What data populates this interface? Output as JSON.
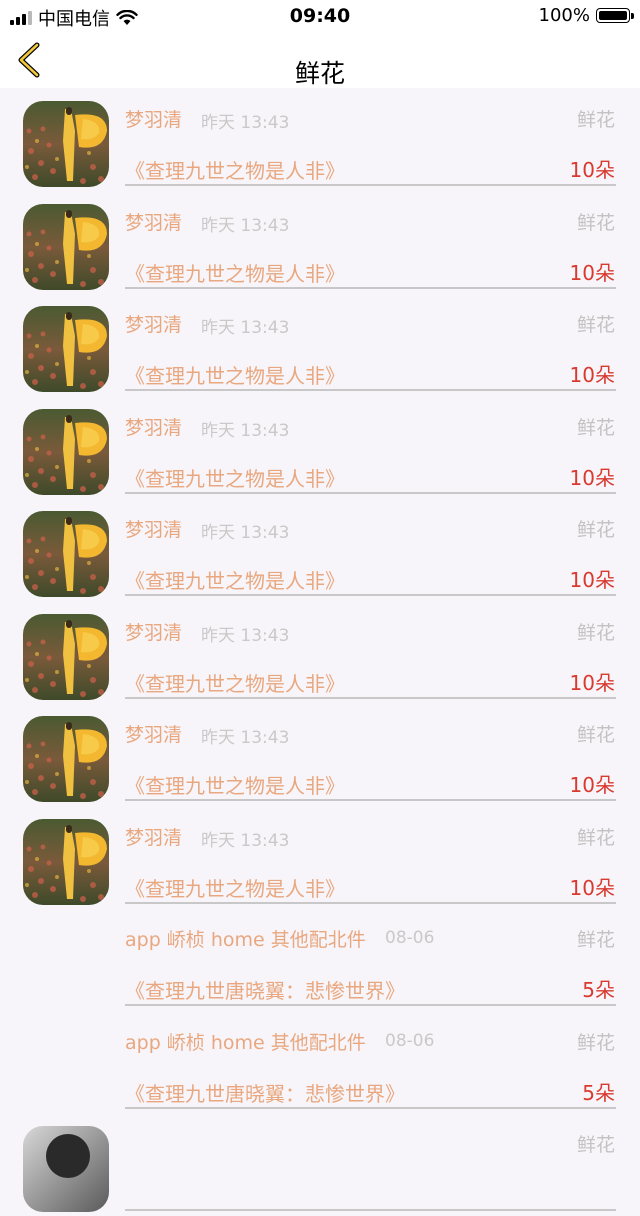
{
  "status_bar": {
    "carrier": "中国电信",
    "time": "09:40",
    "battery": "100%"
  },
  "nav": {
    "title": "鲜花"
  },
  "rows": [
    {
      "has_avatar": true,
      "name": "梦羽清",
      "time": "昨天 13:43",
      "category": "鲜花",
      "book": "《查理九世之物是人非》",
      "amount": "10朵"
    },
    {
      "has_avatar": true,
      "name": "梦羽清",
      "time": "昨天 13:43",
      "category": "鲜花",
      "book": "《查理九世之物是人非》",
      "amount": "10朵"
    },
    {
      "has_avatar": true,
      "name": "梦羽清",
      "time": "昨天 13:43",
      "category": "鲜花",
      "book": "《查理九世之物是人非》",
      "amount": "10朵"
    },
    {
      "has_avatar": true,
      "name": "梦羽清",
      "time": "昨天 13:43",
      "category": "鲜花",
      "book": "《查理九世之物是人非》",
      "amount": "10朵"
    },
    {
      "has_avatar": true,
      "name": "梦羽清",
      "time": "昨天 13:43",
      "category": "鲜花",
      "book": "《查理九世之物是人非》",
      "amount": "10朵"
    },
    {
      "has_avatar": true,
      "name": "梦羽清",
      "time": "昨天 13:43",
      "category": "鲜花",
      "book": "《查理九世之物是人非》",
      "amount": "10朵"
    },
    {
      "has_avatar": true,
      "name": "梦羽清",
      "time": "昨天 13:43",
      "category": "鲜花",
      "book": "《查理九世之物是人非》",
      "amount": "10朵"
    },
    {
      "has_avatar": true,
      "name": "梦羽清",
      "time": "昨天 13:43",
      "category": "鲜花",
      "book": "《查理九世之物是人非》",
      "amount": "10朵"
    },
    {
      "has_avatar": false,
      "name": "app 峤桢 home 其他配北件",
      "time": "08-06",
      "category": "鲜花",
      "book": "《查理九世唐晓翼：悲惨世界》",
      "amount": "5朵"
    },
    {
      "has_avatar": false,
      "name": "app 峤桢 home 其他配北件",
      "time": "08-06",
      "category": "鲜花",
      "book": "《查理九世唐晓翼：悲惨世界》",
      "amount": "5朵"
    },
    {
      "has_avatar": true,
      "avatar_style": "dark",
      "name": "",
      "time": "",
      "category": "鲜花",
      "book": "",
      "amount": ""
    }
  ]
}
